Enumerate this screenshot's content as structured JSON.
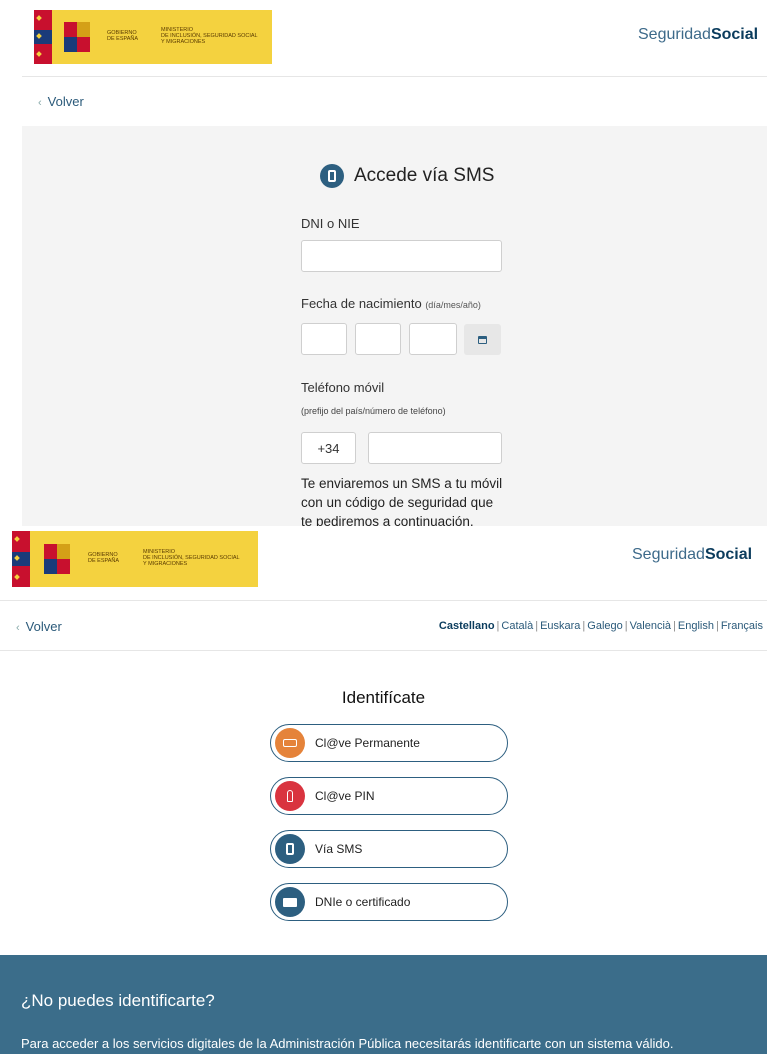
{
  "header": {
    "gobierno": "GOBIERNO\nDE ESPAÑA",
    "ministerio": "MINISTERIO\nDE INCLUSIÓN, SEGURIDAD SOCIAL\nY MIGRACIONES",
    "brand_light": "Seguridad",
    "brand_bold": "Social"
  },
  "nav": {
    "back": "Volver"
  },
  "sms_form": {
    "title": "Accede vía SMS",
    "dni_label": "DNI o NIE",
    "dni_value": "",
    "birth_label": "Fecha de nacimiento",
    "birth_hint": "(día/mes/año)",
    "phone_label": "Teléfono móvil",
    "phone_hint": "(prefijo del país/número de teléfono)",
    "prefix": "+34",
    "phone_value": "",
    "info_line1": "Te enviaremos un SMS a tu móvil",
    "info_line2": "con un código de seguridad que",
    "info_line3": "te pediremos a continuación."
  },
  "languages": {
    "active": "Castellano",
    "others": [
      "Català",
      "Euskara",
      "Galego",
      "Valencià",
      "English",
      "Français"
    ]
  },
  "login": {
    "title": "Identifícate",
    "options": [
      {
        "label": "Cl@ve Permanente",
        "icon": "keypad-icon",
        "color": "#e5833a"
      },
      {
        "label": "Cl@ve PIN",
        "icon": "key-icon",
        "color": "#d9343f"
      },
      {
        "label": "Vía SMS",
        "icon": "mobile-phone-icon",
        "color": "#2d5f80"
      },
      {
        "label": "DNIe o certificado",
        "icon": "id-card-icon",
        "color": "#2d5f80"
      }
    ]
  },
  "footer": {
    "title": "¿No puedes identificarte?",
    "text": "Para acceder a los servicios digitales de la Administración Pública necesitarás identificarte con un sistema válido."
  }
}
